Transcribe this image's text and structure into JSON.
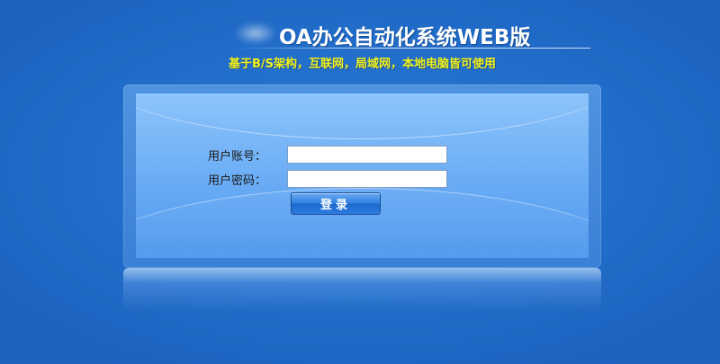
{
  "header": {
    "title": "OA办公自动化系统WEB版",
    "subtitle": "基于B/S架构，互联网，局域网，本地电脑皆可使用"
  },
  "login": {
    "username_label": "用户账号：",
    "username_value": "",
    "password_label": "用户密码：",
    "password_value": "",
    "submit_label": "登录"
  },
  "colors": {
    "background": "#1f6ac6",
    "title_text": "#ffffff",
    "subtitle_text": "#f2f21a",
    "panel_top": "#8ec4fb",
    "panel_bottom": "#4e98ee",
    "button": "#2f7fdf"
  }
}
